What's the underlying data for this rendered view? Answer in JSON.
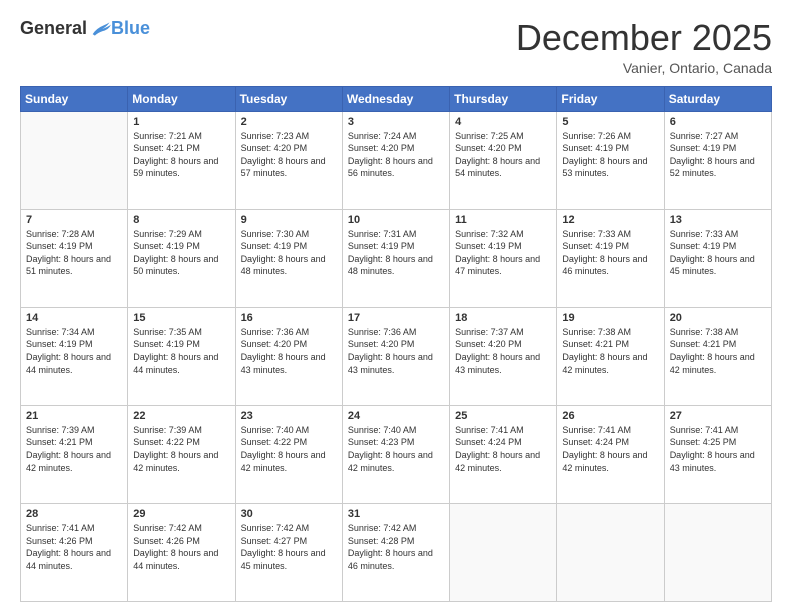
{
  "header": {
    "logo_general": "General",
    "logo_blue": "Blue",
    "month_title": "December 2025",
    "location": "Vanier, Ontario, Canada"
  },
  "days_of_week": [
    "Sunday",
    "Monday",
    "Tuesday",
    "Wednesday",
    "Thursday",
    "Friday",
    "Saturday"
  ],
  "weeks": [
    [
      {
        "day": "",
        "sunrise": "",
        "sunset": "",
        "daylight": ""
      },
      {
        "day": "1",
        "sunrise": "Sunrise: 7:21 AM",
        "sunset": "Sunset: 4:21 PM",
        "daylight": "Daylight: 8 hours and 59 minutes."
      },
      {
        "day": "2",
        "sunrise": "Sunrise: 7:23 AM",
        "sunset": "Sunset: 4:20 PM",
        "daylight": "Daylight: 8 hours and 57 minutes."
      },
      {
        "day": "3",
        "sunrise": "Sunrise: 7:24 AM",
        "sunset": "Sunset: 4:20 PM",
        "daylight": "Daylight: 8 hours and 56 minutes."
      },
      {
        "day": "4",
        "sunrise": "Sunrise: 7:25 AM",
        "sunset": "Sunset: 4:20 PM",
        "daylight": "Daylight: 8 hours and 54 minutes."
      },
      {
        "day": "5",
        "sunrise": "Sunrise: 7:26 AM",
        "sunset": "Sunset: 4:19 PM",
        "daylight": "Daylight: 8 hours and 53 minutes."
      },
      {
        "day": "6",
        "sunrise": "Sunrise: 7:27 AM",
        "sunset": "Sunset: 4:19 PM",
        "daylight": "Daylight: 8 hours and 52 minutes."
      }
    ],
    [
      {
        "day": "7",
        "sunrise": "Sunrise: 7:28 AM",
        "sunset": "Sunset: 4:19 PM",
        "daylight": "Daylight: 8 hours and 51 minutes."
      },
      {
        "day": "8",
        "sunrise": "Sunrise: 7:29 AM",
        "sunset": "Sunset: 4:19 PM",
        "daylight": "Daylight: 8 hours and 50 minutes."
      },
      {
        "day": "9",
        "sunrise": "Sunrise: 7:30 AM",
        "sunset": "Sunset: 4:19 PM",
        "daylight": "Daylight: 8 hours and 48 minutes."
      },
      {
        "day": "10",
        "sunrise": "Sunrise: 7:31 AM",
        "sunset": "Sunset: 4:19 PM",
        "daylight": "Daylight: 8 hours and 48 minutes."
      },
      {
        "day": "11",
        "sunrise": "Sunrise: 7:32 AM",
        "sunset": "Sunset: 4:19 PM",
        "daylight": "Daylight: 8 hours and 47 minutes."
      },
      {
        "day": "12",
        "sunrise": "Sunrise: 7:33 AM",
        "sunset": "Sunset: 4:19 PM",
        "daylight": "Daylight: 8 hours and 46 minutes."
      },
      {
        "day": "13",
        "sunrise": "Sunrise: 7:33 AM",
        "sunset": "Sunset: 4:19 PM",
        "daylight": "Daylight: 8 hours and 45 minutes."
      }
    ],
    [
      {
        "day": "14",
        "sunrise": "Sunrise: 7:34 AM",
        "sunset": "Sunset: 4:19 PM",
        "daylight": "Daylight: 8 hours and 44 minutes."
      },
      {
        "day": "15",
        "sunrise": "Sunrise: 7:35 AM",
        "sunset": "Sunset: 4:19 PM",
        "daylight": "Daylight: 8 hours and 44 minutes."
      },
      {
        "day": "16",
        "sunrise": "Sunrise: 7:36 AM",
        "sunset": "Sunset: 4:20 PM",
        "daylight": "Daylight: 8 hours and 43 minutes."
      },
      {
        "day": "17",
        "sunrise": "Sunrise: 7:36 AM",
        "sunset": "Sunset: 4:20 PM",
        "daylight": "Daylight: 8 hours and 43 minutes."
      },
      {
        "day": "18",
        "sunrise": "Sunrise: 7:37 AM",
        "sunset": "Sunset: 4:20 PM",
        "daylight": "Daylight: 8 hours and 43 minutes."
      },
      {
        "day": "19",
        "sunrise": "Sunrise: 7:38 AM",
        "sunset": "Sunset: 4:21 PM",
        "daylight": "Daylight: 8 hours and 42 minutes."
      },
      {
        "day": "20",
        "sunrise": "Sunrise: 7:38 AM",
        "sunset": "Sunset: 4:21 PM",
        "daylight": "Daylight: 8 hours and 42 minutes."
      }
    ],
    [
      {
        "day": "21",
        "sunrise": "Sunrise: 7:39 AM",
        "sunset": "Sunset: 4:21 PM",
        "daylight": "Daylight: 8 hours and 42 minutes."
      },
      {
        "day": "22",
        "sunrise": "Sunrise: 7:39 AM",
        "sunset": "Sunset: 4:22 PM",
        "daylight": "Daylight: 8 hours and 42 minutes."
      },
      {
        "day": "23",
        "sunrise": "Sunrise: 7:40 AM",
        "sunset": "Sunset: 4:22 PM",
        "daylight": "Daylight: 8 hours and 42 minutes."
      },
      {
        "day": "24",
        "sunrise": "Sunrise: 7:40 AM",
        "sunset": "Sunset: 4:23 PM",
        "daylight": "Daylight: 8 hours and 42 minutes."
      },
      {
        "day": "25",
        "sunrise": "Sunrise: 7:41 AM",
        "sunset": "Sunset: 4:24 PM",
        "daylight": "Daylight: 8 hours and 42 minutes."
      },
      {
        "day": "26",
        "sunrise": "Sunrise: 7:41 AM",
        "sunset": "Sunset: 4:24 PM",
        "daylight": "Daylight: 8 hours and 42 minutes."
      },
      {
        "day": "27",
        "sunrise": "Sunrise: 7:41 AM",
        "sunset": "Sunset: 4:25 PM",
        "daylight": "Daylight: 8 hours and 43 minutes."
      }
    ],
    [
      {
        "day": "28",
        "sunrise": "Sunrise: 7:41 AM",
        "sunset": "Sunset: 4:26 PM",
        "daylight": "Daylight: 8 hours and 44 minutes."
      },
      {
        "day": "29",
        "sunrise": "Sunrise: 7:42 AM",
        "sunset": "Sunset: 4:26 PM",
        "daylight": "Daylight: 8 hours and 44 minutes."
      },
      {
        "day": "30",
        "sunrise": "Sunrise: 7:42 AM",
        "sunset": "Sunset: 4:27 PM",
        "daylight": "Daylight: 8 hours and 45 minutes."
      },
      {
        "day": "31",
        "sunrise": "Sunrise: 7:42 AM",
        "sunset": "Sunset: 4:28 PM",
        "daylight": "Daylight: 8 hours and 46 minutes."
      },
      {
        "day": "",
        "sunrise": "",
        "sunset": "",
        "daylight": ""
      },
      {
        "day": "",
        "sunrise": "",
        "sunset": "",
        "daylight": ""
      },
      {
        "day": "",
        "sunrise": "",
        "sunset": "",
        "daylight": ""
      }
    ]
  ]
}
